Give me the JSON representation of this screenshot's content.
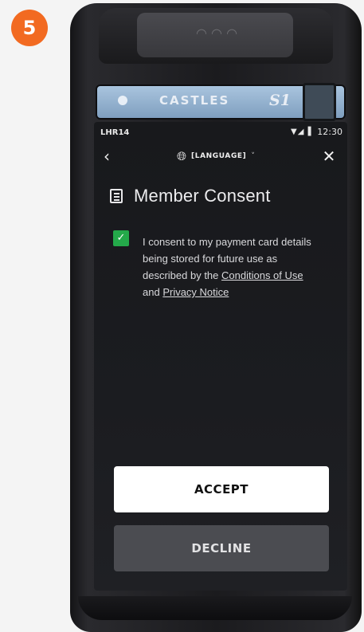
{
  "step_badge": "5",
  "device": {
    "brand": "CASTLES",
    "model": "S1"
  },
  "status_bar": {
    "carrier": "LHR14",
    "icons": "▼◢ ▌",
    "time": "12:30"
  },
  "nav": {
    "back_glyph": "‹",
    "close_glyph": "✕",
    "language_label": "[LANGUAGE]",
    "language_chevron": "˅"
  },
  "title": "Member Consent",
  "consent": {
    "checked": true,
    "text_before": "I consent to my payment card details being stored for future use as described by the ",
    "link_terms": "Conditions of Use",
    "text_and": " and ",
    "link_privacy": "Privacy Notice"
  },
  "buttons": {
    "accept": "ACCEPT",
    "decline": "DECLINE"
  },
  "colors": {
    "accent_orange": "#f26a21",
    "checkbox_green": "#24a94a",
    "screen_bg": "#18191c"
  }
}
